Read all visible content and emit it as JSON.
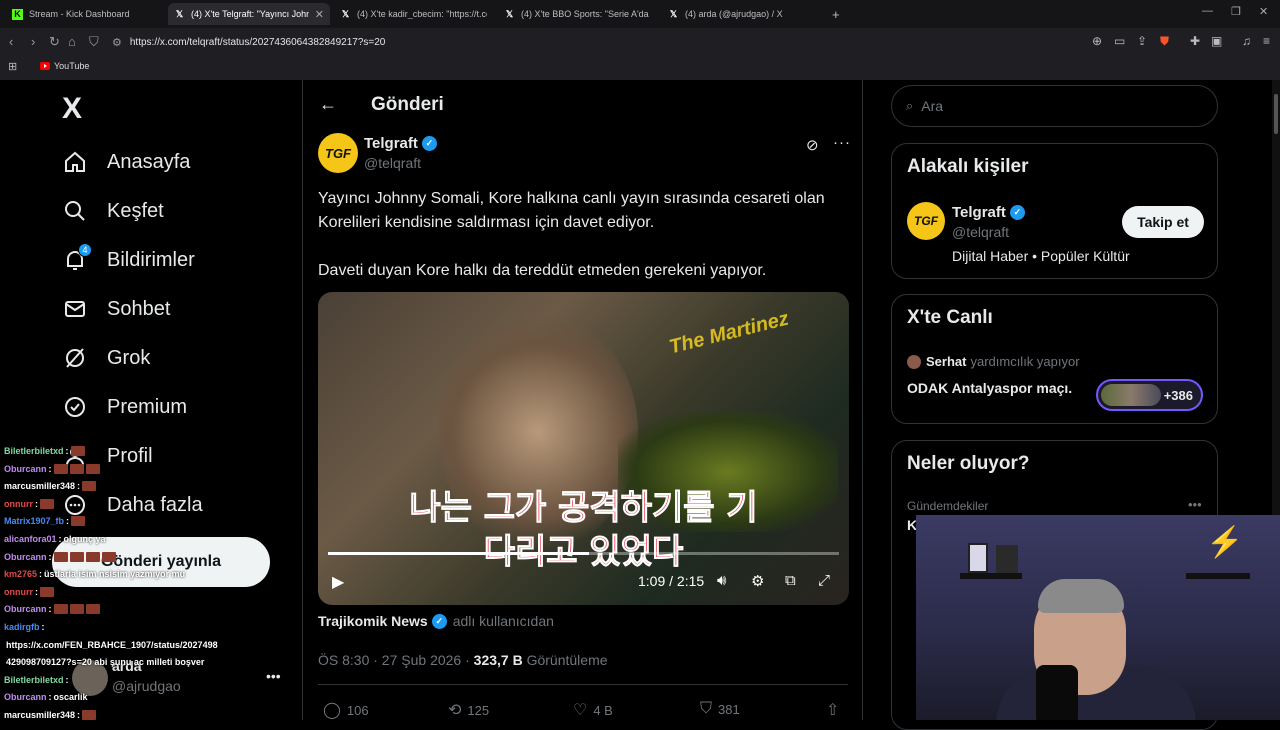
{
  "browser": {
    "tabs": [
      {
        "icon": "kick-icon",
        "label": "Stream - Kick Dashboard"
      },
      {
        "icon": "x-icon",
        "label": "(4) X'te Telgraft: \"Yayıncı Johnny"
      },
      {
        "icon": "x-icon",
        "label": "(4) X'te kadir_cbecim: \"https://t.co/M"
      },
      {
        "icon": "x-icon",
        "label": "(4) X'te BBO Sports: \"Serie A'da belki"
      },
      {
        "icon": "x-icon",
        "label": "(4) arda (@ajrudgao) / X"
      }
    ],
    "new_tab": "+",
    "url": "https://x.com/telqraft/status/2027436064382849217?s=20",
    "bookmark": "YouTube"
  },
  "sidebar": {
    "logo": "X",
    "items": [
      {
        "label": "Anasayfa",
        "icon": "home-icon"
      },
      {
        "label": "Keşfet",
        "icon": "search-icon"
      },
      {
        "label": "Bildirimler",
        "icon": "bell-icon",
        "badge": "4"
      },
      {
        "label": "Sohbet",
        "icon": "mail-icon"
      },
      {
        "label": "Grok",
        "icon": "grok-icon"
      },
      {
        "label": "Premium",
        "icon": "verified-icon"
      },
      {
        "label": "Profil",
        "icon": "person-icon"
      },
      {
        "label": "Daha fazla",
        "icon": "more-circle-icon"
      }
    ],
    "post_button": "Gönderi yayınla",
    "user": {
      "name": "arda",
      "handle": "@ajrudgao"
    }
  },
  "main": {
    "title": "Gönderi",
    "tweet": {
      "avatar_text": "TGF",
      "name": "Telgraft",
      "handle": "@telqraft",
      "text1": "Yayıncı Johnny Somali, Kore halkına canlı yayın sırasında cesareti olan Korelileri kendisine saldırması için davet ediyor.",
      "text2": "Daveti duyan Kore halkı da tereddüt etmeden gerekeni yapıyor.",
      "video": {
        "sign_text": "The Martinez",
        "subtitle1": "나는 그가 공격하기를 기",
        "subtitle2": "다리고 있었다",
        "time": "1:09 / 2:15",
        "progress": 0.51
      },
      "source_name": "Trajikomik News",
      "source_suffix": "adlı kullanıcıdan",
      "time": "ÖS 8:30 · 27 Şub 2026 · ",
      "views": "323,7 B",
      "views_label": "Görüntüleme",
      "replies": "106",
      "reposts": "125",
      "likes": "4 B",
      "bookmarks": "381"
    }
  },
  "right": {
    "search_placeholder": "Ara",
    "related": {
      "title": "Alakalı kişiler",
      "name": "Telgraft",
      "handle": "@telqraft",
      "bio": "Dijital Haber • Popüler Kültür",
      "follow": "Takip et"
    },
    "live": {
      "title": "X'te Canlı",
      "host": "Serhat",
      "activity": "yardımcılık yapıyor",
      "space": "ODAK Antalyaspor maçı.",
      "count": "+386"
    },
    "trends": {
      "title": "Neler oluyor?",
      "category": "Gündemdekiler",
      "first_letter": "K"
    }
  },
  "chat": [
    {
      "user": "Biletlerbiletxd",
      "color": "#7fd8a0",
      "msg": "",
      "emotes": 1
    },
    {
      "user": "Oburcann",
      "color": "#c08af0",
      "msg": "",
      "emotes": 3
    },
    {
      "user": "marcusmiller348",
      "color": "#ffffff",
      "msg": "",
      "emotes": 1
    },
    {
      "user": "onnurr",
      "color": "#e04a4a",
      "msg": "",
      "emotes": 1
    },
    {
      "user": "Matrix1907_fb",
      "color": "#4a8af0",
      "msg": "",
      "emotes": 1
    },
    {
      "user": "alicanfora01",
      "color": "#c08af0",
      "msg": "olgunç ya",
      "emotes": 0
    },
    {
      "user": "Oburcann",
      "color": "#c08af0",
      "msg": "",
      "emotes": 4
    },
    {
      "user": "km2765",
      "color": "#e04a4a",
      "msg": "üstlarla isim nsisim yazmıyor mu",
      "emotes": 0
    },
    {
      "user": "onnurr",
      "color": "#e04a4a",
      "msg": "",
      "emotes": 1
    },
    {
      "user": "Oburcann",
      "color": "#c08af0",
      "msg": "",
      "emotes": 3
    },
    {
      "user": "kadirgfb",
      "color": "#4a8af0",
      "msg": "",
      "emotes": 0
    },
    {
      "user": "",
      "color": "#ffffff",
      "msg": "https://x.com/FEN_RBAHCE_1907/status/2027498",
      "emotes": 0
    },
    {
      "user": "",
      "color": "#ffffff",
      "msg": "429098709127?s=20 abi şunu ac milleti boşver",
      "emotes": 0
    },
    {
      "user": "Biletlerbiletxd",
      "color": "#7fd8a0",
      "msg": "",
      "emotes": 0
    },
    {
      "user": "Oburcann",
      "color": "#c08af0",
      "msg": "oscarlik",
      "emotes": 0
    },
    {
      "user": "marcusmiller348",
      "color": "#ffffff",
      "msg": "",
      "emotes": 1
    }
  ]
}
